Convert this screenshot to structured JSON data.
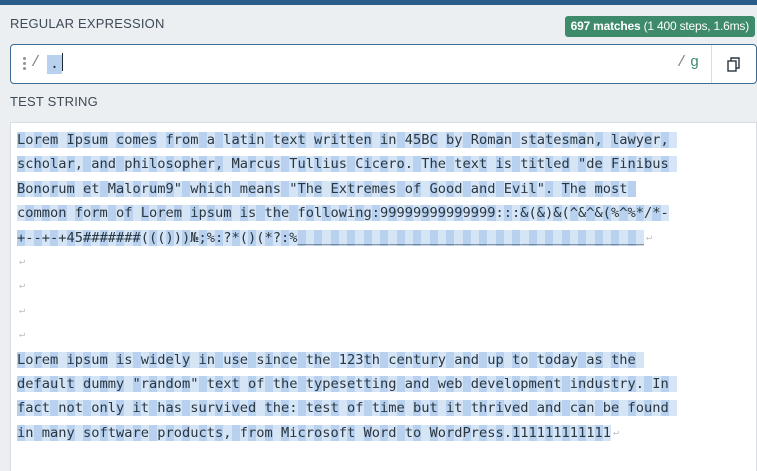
{
  "header": {
    "regex_label": "REGULAR EXPRESSION",
    "match_count": "697 matches",
    "match_steps": "(1 400 steps, 1.6ms)"
  },
  "regex": {
    "open_delimiter": "/",
    "pattern": ".",
    "close_delimiter": "/",
    "flags": "g",
    "copy_icon": "copy-icon"
  },
  "test": {
    "label": "TEST STRING",
    "lines": [
      "Lorem Ipsum comes from a latin text written in 45BC by Roman statesman, lawyer, ",
      "scholar, and philosopher, Marcus Tullius Cicero. The text is titled \"de Finibus ",
      "Bonorum et Malorum9\" which means \"The Extremes of Good and Evil\". The most ",
      "common form of Lorem ipsum is the following:99999999999999:::&(&)&(^&^&(%^%*/*-",
      "+--+-+45#######((()))№;%:?*()(*?:%__________________________________________",
      "",
      "",
      "",
      "",
      "Lorem ipsum is widely in use since the 123th century and up to today as the ",
      "default dummy \"random\" text of the typesetting and web development industry. In ",
      "fact not only it has survived the: test of time but it thrived and can be found ",
      "in many software products, from Microsoft Word to WordPress.111111111111"
    ]
  }
}
